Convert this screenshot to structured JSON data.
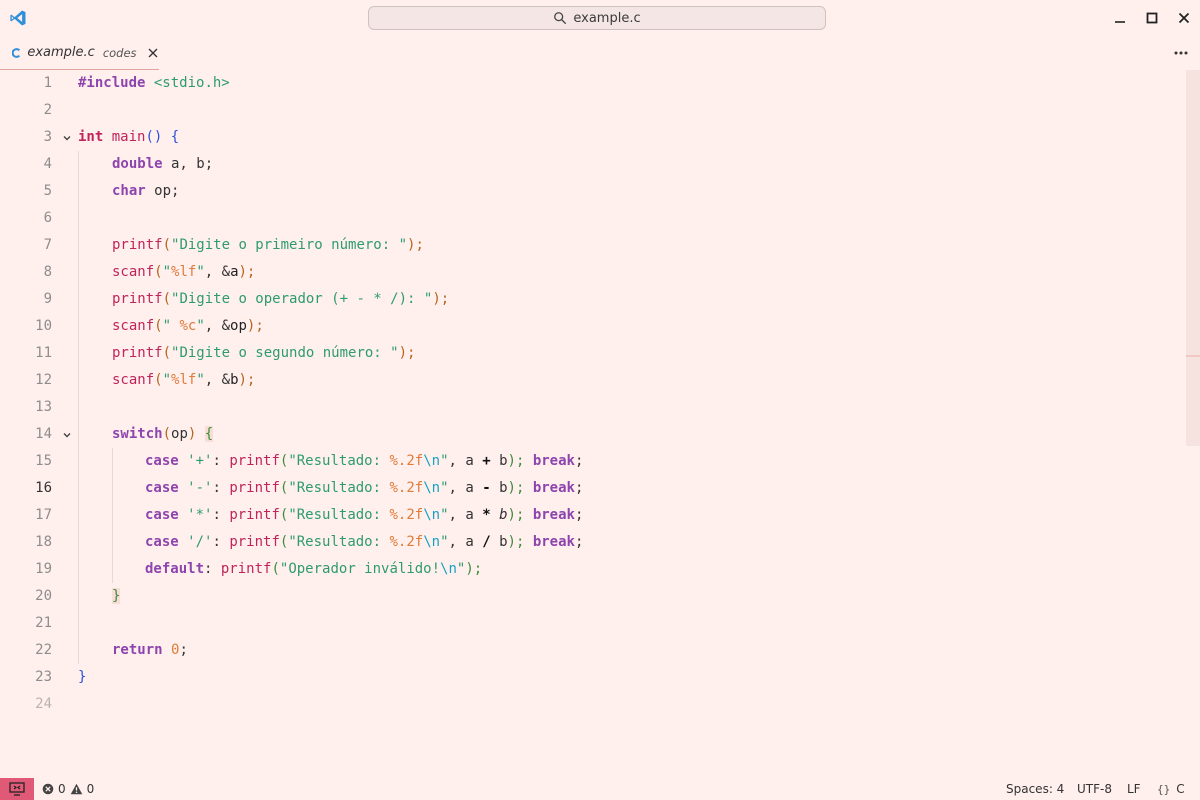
{
  "window": {
    "search_label": "example.c"
  },
  "tab": {
    "name": "example.c",
    "description": "codes"
  },
  "editor": {
    "active_line": 16,
    "line_numbers": [
      "1",
      "2",
      "3",
      "4",
      "5",
      "6",
      "7",
      "8",
      "9",
      "10",
      "11",
      "12",
      "13",
      "14",
      "15",
      "16",
      "17",
      "18",
      "19",
      "20",
      "21",
      "22",
      "23",
      "24"
    ]
  },
  "code": {
    "l1": {
      "a": "#include",
      "b": " <stdio.h>"
    },
    "l3": {
      "a": "int",
      "b": " ",
      "c": "main",
      "d": "()",
      "e": " ",
      "f": "{"
    },
    "l4": {
      "a": "double",
      "b": " a, b;"
    },
    "l5": {
      "a": "char",
      "b": " op;"
    },
    "l7": {
      "a": "printf",
      "b": "(",
      "c": "\"Digite o primeiro número: \"",
      "d": ");"
    },
    "l8": {
      "a": "scanf",
      "b": "(",
      "c": "\"",
      "d": "%lf",
      "e": "\"",
      "f": ", &",
      "g": "a",
      "h": ");"
    },
    "l9": {
      "a": "printf",
      "b": "(",
      "c": "\"Digite o operador (+ - * /): \"",
      "d": ");"
    },
    "l10": {
      "a": "scanf",
      "b": "(",
      "c": "\" ",
      "d": "%c",
      "e": "\"",
      "f": ", &",
      "g": "op",
      "h": ");"
    },
    "l11": {
      "a": "printf",
      "b": "(",
      "c": "\"Digite o segundo número: \"",
      "d": ");"
    },
    "l12": {
      "a": "scanf",
      "b": "(",
      "c": "\"",
      "d": "%lf",
      "e": "\"",
      "f": ", &",
      "g": "b",
      "h": ");"
    },
    "l14": {
      "a": "switch",
      "b": "(",
      "c": "op",
      "d": ")",
      "e": " ",
      "f": "{"
    },
    "l15": {
      "a": "case",
      "b": " ",
      "c": "'+'",
      "d": ": ",
      "e": "printf",
      "f": "(",
      "g": "\"Resultado: ",
      "h": "%.2f",
      "i": "\\n",
      "j": "\"",
      "k": ", a ",
      "l": "+",
      "m": " b",
      "n": "); ",
      "o": "break",
      "p": ";"
    },
    "l16": {
      "a": "case",
      "b": " ",
      "c": "'-'",
      "d": ": ",
      "e": "printf",
      "f": "(",
      "g": "\"Resultado: ",
      "h": "%.2f",
      "i": "\\n",
      "j": "\"",
      "k": ", a ",
      "l": "-",
      "m": " b",
      "n": "); ",
      "o": "break",
      "p": ";"
    },
    "l17": {
      "a": "case",
      "b": " ",
      "c": "'*'",
      "d": ": ",
      "e": "printf",
      "f": "(",
      "g": "\"Resultado: ",
      "h": "%.2f",
      "i": "\\n",
      "j": "\"",
      "k": ", a ",
      "l": "*",
      "m": " b",
      "n": "); ",
      "o": "break",
      "p": ";"
    },
    "l18": {
      "a": "case",
      "b": " ",
      "c": "'/'",
      "d": ": ",
      "e": "printf",
      "f": "(",
      "g": "\"Resultado: ",
      "h": "%.2f",
      "i": "\\n",
      "j": "\"",
      "k": ", a ",
      "l": "/",
      "m": " b",
      "n": "); ",
      "o": "break",
      "p": ";"
    },
    "l19": {
      "a": "default",
      "b": ": ",
      "c": "printf",
      "d": "(",
      "e": "\"Operador inválido!",
      "f": "\\n",
      "g": "\"",
      "h": ");"
    },
    "l20": {
      "a": "}"
    },
    "l22": {
      "a": "return",
      "b": " ",
      "c": "0",
      "d": ";"
    },
    "l23": {
      "a": "}"
    }
  },
  "statusbar": {
    "errors": "0",
    "warnings": "0",
    "indentation": "Spaces: 4",
    "encoding": "UTF-8",
    "eol": "LF",
    "language": "C"
  },
  "colors": {
    "background": "#fff0ee",
    "accent": "#e05a78",
    "keyword": "#8e44ad",
    "function": "#c0245a",
    "string": "#2e9b6f"
  },
  "icons": [
    "vscode-logo-icon",
    "search-icon",
    "minimize-icon",
    "maximize-icon",
    "close-icon",
    "c-file-icon",
    "tab-close-icon",
    "more-actions-icon",
    "fold-chevron-icon",
    "remote-icon",
    "error-icon",
    "warning-icon",
    "braces-icon"
  ]
}
